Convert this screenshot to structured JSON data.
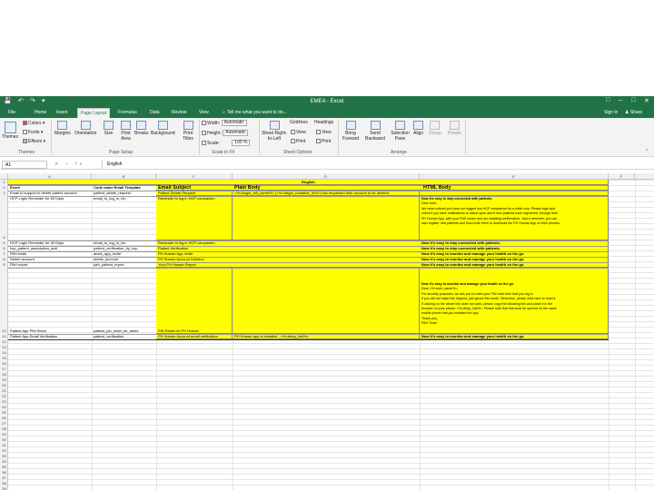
{
  "window": {
    "title": "EMEA - Excel"
  },
  "quick_access": {
    "save": "💾",
    "undo": "↶",
    "redo": "↷"
  },
  "tabs": [
    "File",
    "Home",
    "Insert",
    "Page Layout",
    "Formulas",
    "Data",
    "Review",
    "View"
  ],
  "tell_me": "Tell me what you want to do...",
  "account": {
    "sign_in": "Sign in",
    "share": "Share"
  },
  "ribbon": {
    "themes": {
      "themes": "Themes",
      "colors": "Colors",
      "fonts": "Fonts",
      "effects": "Effects",
      "group": "Themes"
    },
    "page_setup": {
      "margins": "Margins",
      "orientation": "Orientation",
      "size": "Size",
      "print_area": "Print Area",
      "breaks": "Breaks",
      "background": "Background",
      "print_titles": "Print Titles",
      "group": "Page Setup"
    },
    "scale": {
      "width_label": "Width:",
      "width_value": "Automatic",
      "height_label": "Height:",
      "height_value": "Automatic",
      "scale_label": "Scale:",
      "scale_value": "100 %",
      "group": "Scale to Fit"
    },
    "sheet_options": {
      "rtl": "Sheet Right-to-Left",
      "gridlines": "Gridlines",
      "headings": "Headings",
      "view": "View",
      "print": "Print",
      "group": "Sheet Options"
    },
    "arrange": {
      "bring_forward": "Bring Forward",
      "send_backward": "Send Backward",
      "selection_pane": "Selection Pane",
      "align": "Align",
      "group_btn": "Group",
      "rotate": "Rotate",
      "group": "Arrange"
    }
  },
  "formula_bar": {
    "cell_ref": "A1",
    "icons": "✕ ✓ fx",
    "content": "English"
  },
  "columns": [
    "A",
    "B",
    "C",
    "D",
    "E",
    "F"
  ],
  "rows": [
    "1",
    "2",
    "3",
    "4",
    "5",
    "6",
    "7",
    "8",
    "9",
    "10",
    "11",
    "12",
    "13",
    "14",
    "15",
    "16",
    "17",
    "18",
    "19",
    "20",
    "21",
    "22",
    "23",
    "24",
    "25",
    "26",
    "27",
    "28",
    "29",
    "30",
    "31",
    "32",
    "33",
    "34",
    "35",
    "36",
    "37",
    "38",
    "39",
    "40",
    "41",
    "42",
    "43",
    "44",
    "45",
    "46",
    "47",
    "48",
    "49",
    "50",
    "51",
    "52",
    "53",
    "54",
    "55",
    "56",
    "57"
  ],
  "sheet": {
    "title": "English",
    "headers": {
      "event": "Event",
      "code_name": "Code name Email Template",
      "email_subject": "Email Subject",
      "plain_body": "Plain Body",
      "html_body": "HTML Body"
    },
    "r3": {
      "event": "Email to support to delete patient account",
      "code": "patient_delete_request",
      "subject": "Patient Delete Request",
      "plain": "<%=target_full_name%> (<%=target_readable_id%>) has requested their account to be deleted."
    },
    "r4": {
      "event": "HCP Login Reminder for 60 Days",
      "code": "email_to_log_in_hin",
      "subject": "Reminder to log in HCP companion",
      "html": [
        "Now it's easy to stay connected with patients.",
        "Dear User,",
        "We have noticed you have not logged into HCP companion for a while now. Please login and",
        "check if you have notifications to action upon and if new patients have registered, through their",
        "PH Human App, with your PAH centre and are awaiting confirmation. Just a reminder, you can",
        "also register new patients and thus invite them to download the PH Human App on their phones."
      ]
    },
    "r5": {
      "event": "HCP Login Reminder for 30 Days",
      "code": "email_to_log_in_hin",
      "subject": "Reminder to log in HCP companion",
      "html": "Now it's easy to stay connected with patients."
    },
    "r6": {
      "event": "hcp_patient_association_add",
      "code": "patient_verification_by_hcp",
      "subject": "Patient Verification",
      "html": "Now it's easy to stay connected with patients."
    },
    "r7": {
      "event": "PAH invite",
      "code": "ames_app_invite",
      "subject": "PH Human App Invite",
      "html": "Now it's easy to monitor and manage your health on the go."
    },
    "r8": {
      "event": "Delete account",
      "code": "delete_account",
      "subject": "PH Human Account Deletion",
      "html": "Now it's easy to monitor and manage your health on the go."
    },
    "r9": {
      "event": "PAH report",
      "code": "pah_patient_report",
      "subject": "Your PH Human Report",
      "html": "Now it's easy to monitor and manage your health on the go."
    },
    "r10": {
      "event": "Patient App PIN Reset",
      "code": "patient_pin_reset_en_ames",
      "subject": "PIN Reset for PH Human",
      "html": [
        "Now it's easy to monitor and manage your health on the go.",
        "Dear <%=user_name%>,",
        "For security purposes, we ask you to reset your PIN each time that you log in.",
        "If you did not make this request, just ignore this email. Otherwise, please click here to reset it.",
        "If clicking on the above link does not work, please copy the following link and paste it in the",
        "browser on your phone: <%=deep_link%>. Please note that this must be opened on the same",
        "mobile phone that you installed the app.",
        "Thank you,",
        "PAH Team"
      ]
    },
    "r11": {
      "event": "Patient App Email Verification",
      "code": "patient_verification",
      "subject": "PH Human Account email verification",
      "plain": "PH Human app is installed - <%=deep_link%>",
      "html": "Now it's easy to monitor and manage your health on the go."
    }
  }
}
